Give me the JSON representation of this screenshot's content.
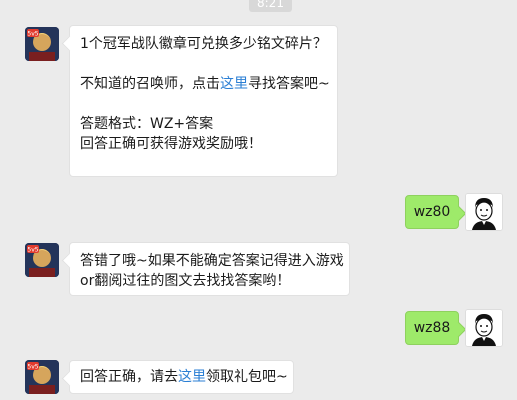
{
  "time": "8:21",
  "colors": {
    "link": "#2b7fd4",
    "out_bubble": "#9eea6a"
  },
  "messages": {
    "m1": {
      "line1": "1个冠军战队徽章可兑换多少铭文碎片？",
      "line2_pre": "不知道的召唤师，点击",
      "line2_link": "这里",
      "line2_post": "寻找答案吧~",
      "line3": "答题格式：WZ+答案",
      "line4": "回答正确可获得游戏奖励哦！"
    },
    "m2": {
      "text": "wz80"
    },
    "m3": {
      "line1": "答错了哦~如果不能确定答案记得进入游戏",
      "line2": "or翻阅过往的图文去找找答案哟！"
    },
    "m4": {
      "text": "wz88"
    },
    "m5": {
      "pre": "回答正确，请去",
      "link": "这里",
      "post": "领取礼包吧~"
    }
  },
  "icons": {
    "game_avatar": "game-character-avatar-icon",
    "user_avatar": "user-cartoon-avatar-icon",
    "badge": "5v5-badge-icon"
  }
}
